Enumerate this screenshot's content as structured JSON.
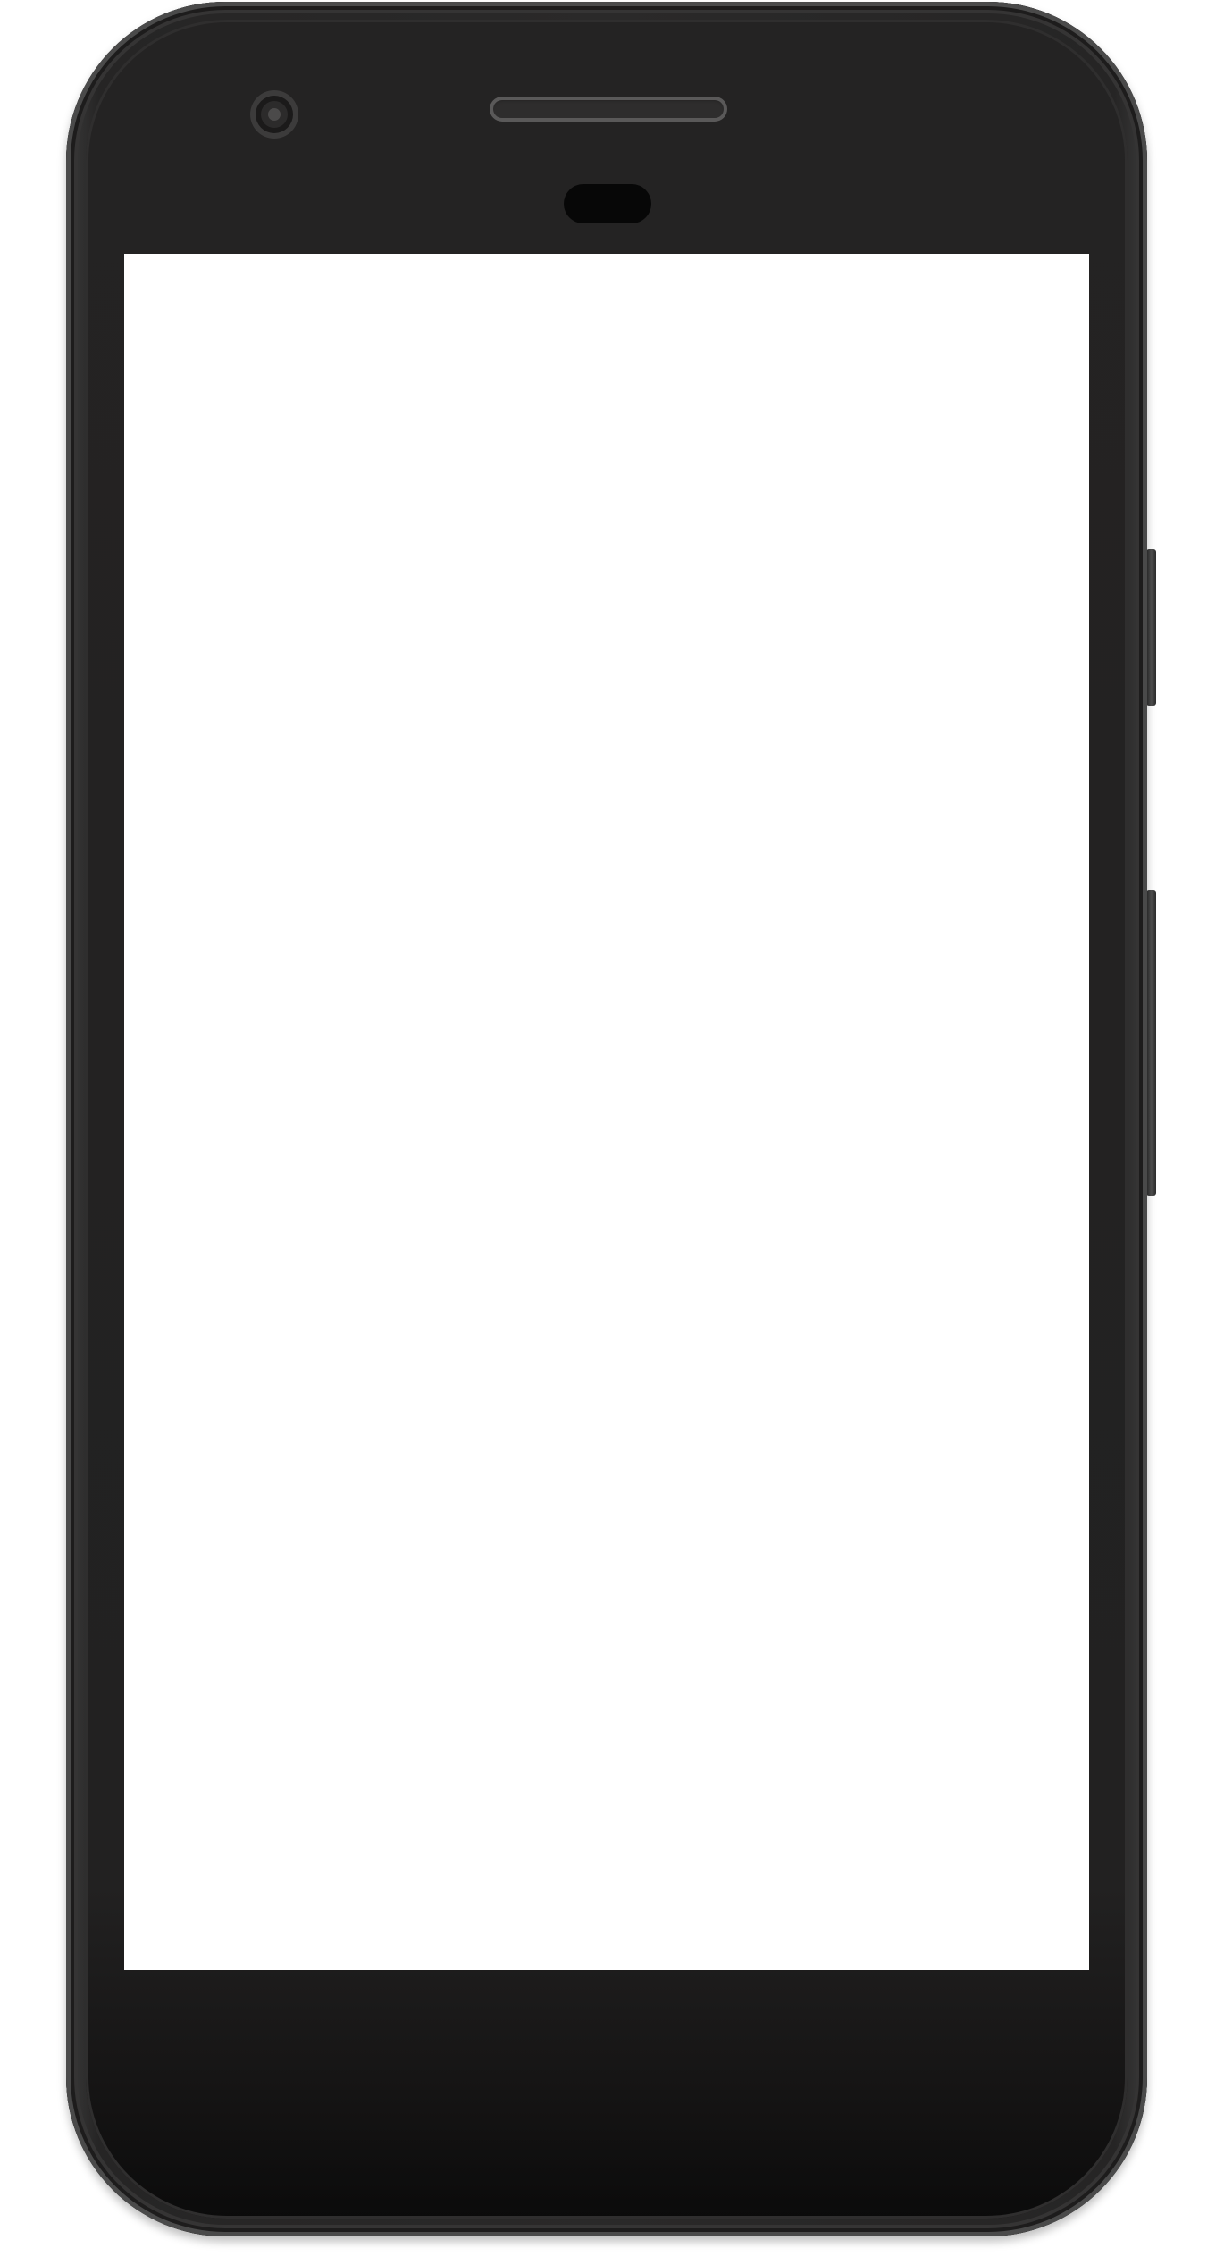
{
  "device": {
    "type": "smartphone",
    "color": "#262525",
    "screen": {
      "state": "blank",
      "background": "#ffffff"
    },
    "icons": {
      "front_camera": "camera-icon",
      "earpiece": "speaker-icon",
      "sensor": "sensor-icon"
    }
  }
}
